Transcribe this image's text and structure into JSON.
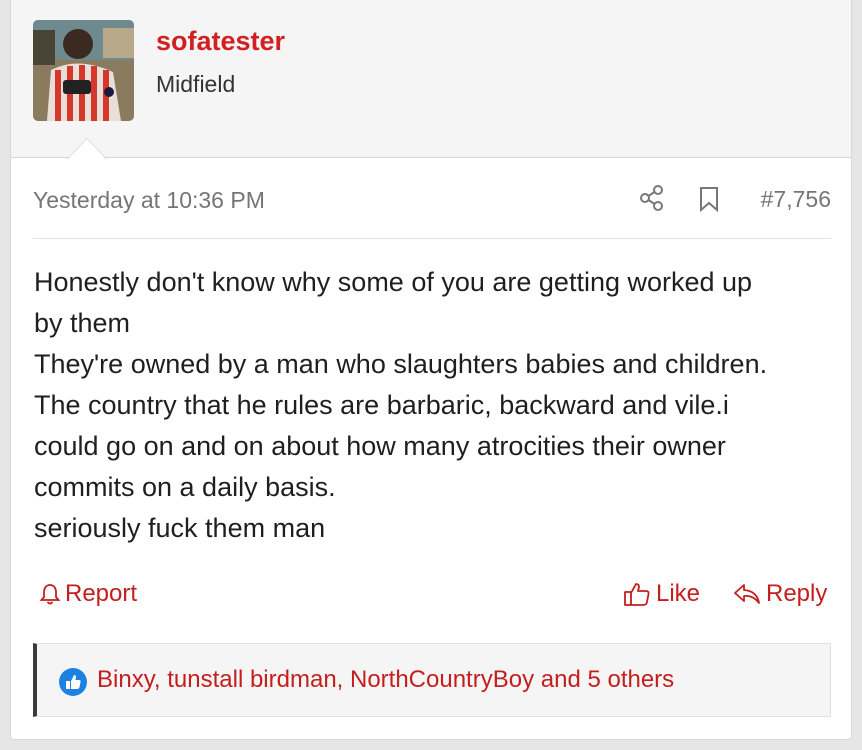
{
  "user": {
    "name": "sofatester",
    "title": "Midfield"
  },
  "post": {
    "date": "Yesterday at 10:36 PM",
    "number": "#7,756",
    "lines": [
      "Honestly don't know why some of you are getting worked up",
      "by them",
      "They're owned by a man who slaughters babies and children.",
      "The country that he rules are barbaric, backward and vile.i",
      "could go on and on about how many atrocities their owner",
      "commits on a daily basis.",
      "seriously fuck them man"
    ]
  },
  "actions": {
    "report": "Report",
    "like": "Like",
    "reply": "Reply"
  },
  "reactions": {
    "text": "Binxy, tunstall birdman, NorthCountryBoy and 5 others"
  },
  "colors": {
    "accent": "#d21f1f",
    "link": "#c41e1e",
    "like_badge": "#1b82e0"
  },
  "icons": {
    "share": "share-icon",
    "bookmark": "bookmark-icon",
    "report": "bell-icon",
    "like": "thumbs-up-icon",
    "reply": "reply-arrow-icon",
    "reaction": "like-reaction-icon"
  }
}
